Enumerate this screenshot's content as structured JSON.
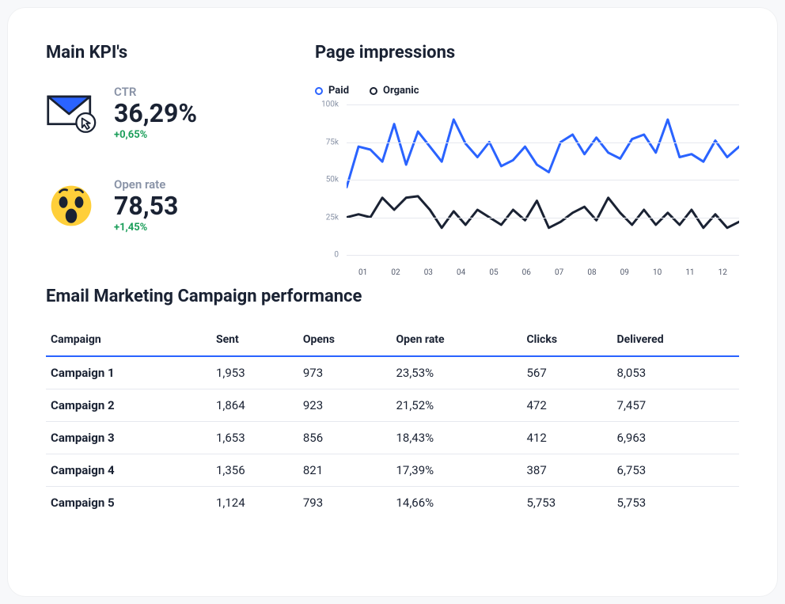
{
  "kpi_section_title": "Main KPI's",
  "kpis": [
    {
      "id": "ctr",
      "label": "CTR",
      "value": "36,29%",
      "delta": "+0,65%",
      "icon": "envelope-click-icon"
    },
    {
      "id": "openrate",
      "label": "Open rate",
      "value": "78,53",
      "delta": "+1,45%",
      "icon": "wow-face-icon"
    }
  ],
  "impressions_title": "Page impressions",
  "legend": {
    "paid": "Paid",
    "organic": "Organic"
  },
  "chart_data": {
    "type": "line",
    "title": "Page impressions",
    "xlabel": "",
    "ylabel": "",
    "ylim": [
      0,
      100000
    ],
    "y_ticks": [
      "0",
      "25k",
      "50k",
      "75k",
      "100k"
    ],
    "categories": [
      "01",
      "02",
      "03",
      "04",
      "05",
      "06",
      "07",
      "08",
      "09",
      "10",
      "11",
      "12"
    ],
    "series": [
      {
        "name": "Paid",
        "color": "#2a63ff",
        "values": [
          45000,
          72000,
          70000,
          62000,
          87000,
          60000,
          82000,
          72000,
          62000,
          90000,
          74000,
          65000,
          75000,
          59000,
          63000,
          72000,
          60000,
          55000,
          75000,
          80000,
          67000,
          78000,
          68000,
          64000,
          77000,
          80000,
          68000,
          90000,
          65000,
          67000,
          62000,
          76000,
          65000,
          72000
        ]
      },
      {
        "name": "Organic",
        "color": "#1a2233",
        "values": [
          25000,
          27000,
          25000,
          38000,
          30000,
          38000,
          39000,
          30000,
          18000,
          29000,
          20000,
          30000,
          25000,
          20000,
          30000,
          23000,
          36000,
          18000,
          22000,
          28000,
          32000,
          23000,
          38000,
          28000,
          20000,
          30000,
          20000,
          28000,
          20000,
          30000,
          18000,
          27000,
          18000,
          22000
        ]
      }
    ]
  },
  "table_title": "Email Marketing Campaign performance",
  "table": {
    "columns": [
      "Campaign",
      "Sent",
      "Opens",
      "Open rate",
      "Clicks",
      "Delivered"
    ],
    "rows": [
      [
        "Campaign 1",
        "1,953",
        "973",
        "23,53%",
        "567",
        "8,053"
      ],
      [
        "Campaign 2",
        "1,864",
        "923",
        "21,52%",
        "472",
        "7,457"
      ],
      [
        "Campaign 3",
        "1,653",
        "856",
        "18,43%",
        "412",
        "6,963"
      ],
      [
        "Campaign 4",
        "1,356",
        "821",
        "17,39%",
        "387",
        "6,753"
      ],
      [
        "Campaign 5",
        "1,124",
        "793",
        "14,66%",
        "5,753",
        "5,753"
      ]
    ]
  }
}
